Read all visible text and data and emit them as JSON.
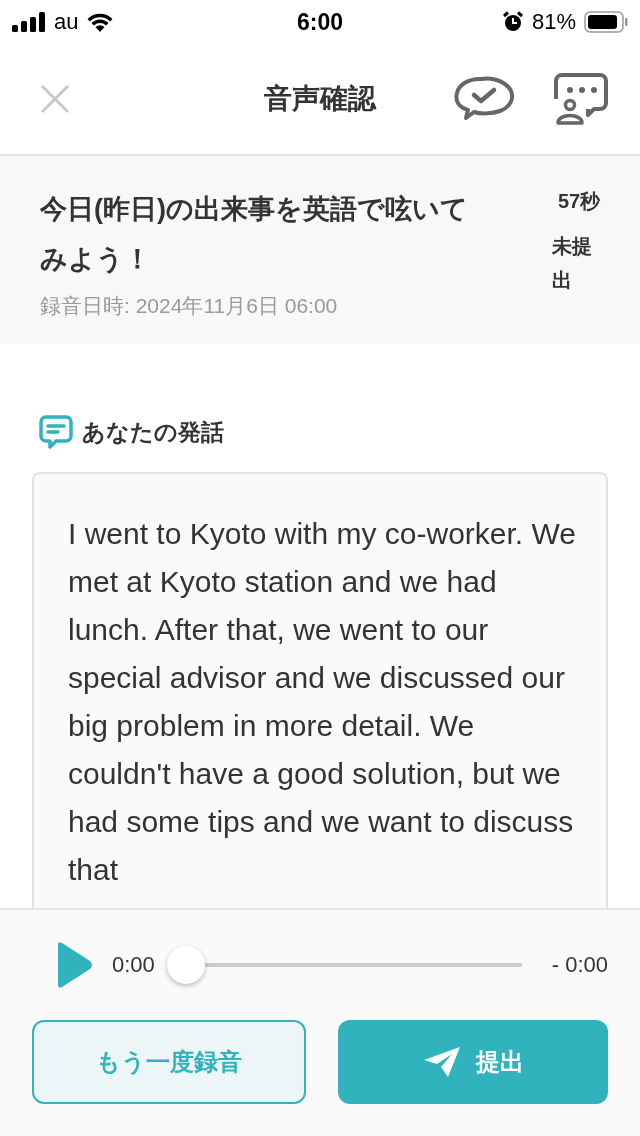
{
  "status_bar": {
    "carrier": "au",
    "time": "6:00",
    "battery": "81%"
  },
  "header": {
    "title": "音声確認"
  },
  "task": {
    "title": "今日(昨日)の出来事を英語で呟いてみよう！",
    "recorded_at": "録音日時: 2024年11月6日 06:00",
    "duration": "57秒",
    "status": "未提出"
  },
  "speech": {
    "label": "あなたの発話",
    "transcript": "I went to Kyoto with my co-worker. We met at Kyoto station and we had lunch. After that, we went to our special advisor and we discussed our big problem in more detail. We couldn't have a good solution, but we had some tips and we want to discuss that"
  },
  "player": {
    "elapsed": "0:00",
    "remaining": "- 0:00",
    "level": 0
  },
  "buttons": [
    {
      "label": "もう一度録音",
      "kind": "secondary"
    },
    {
      "label": "提出",
      "kind": "primary"
    }
  ]
}
